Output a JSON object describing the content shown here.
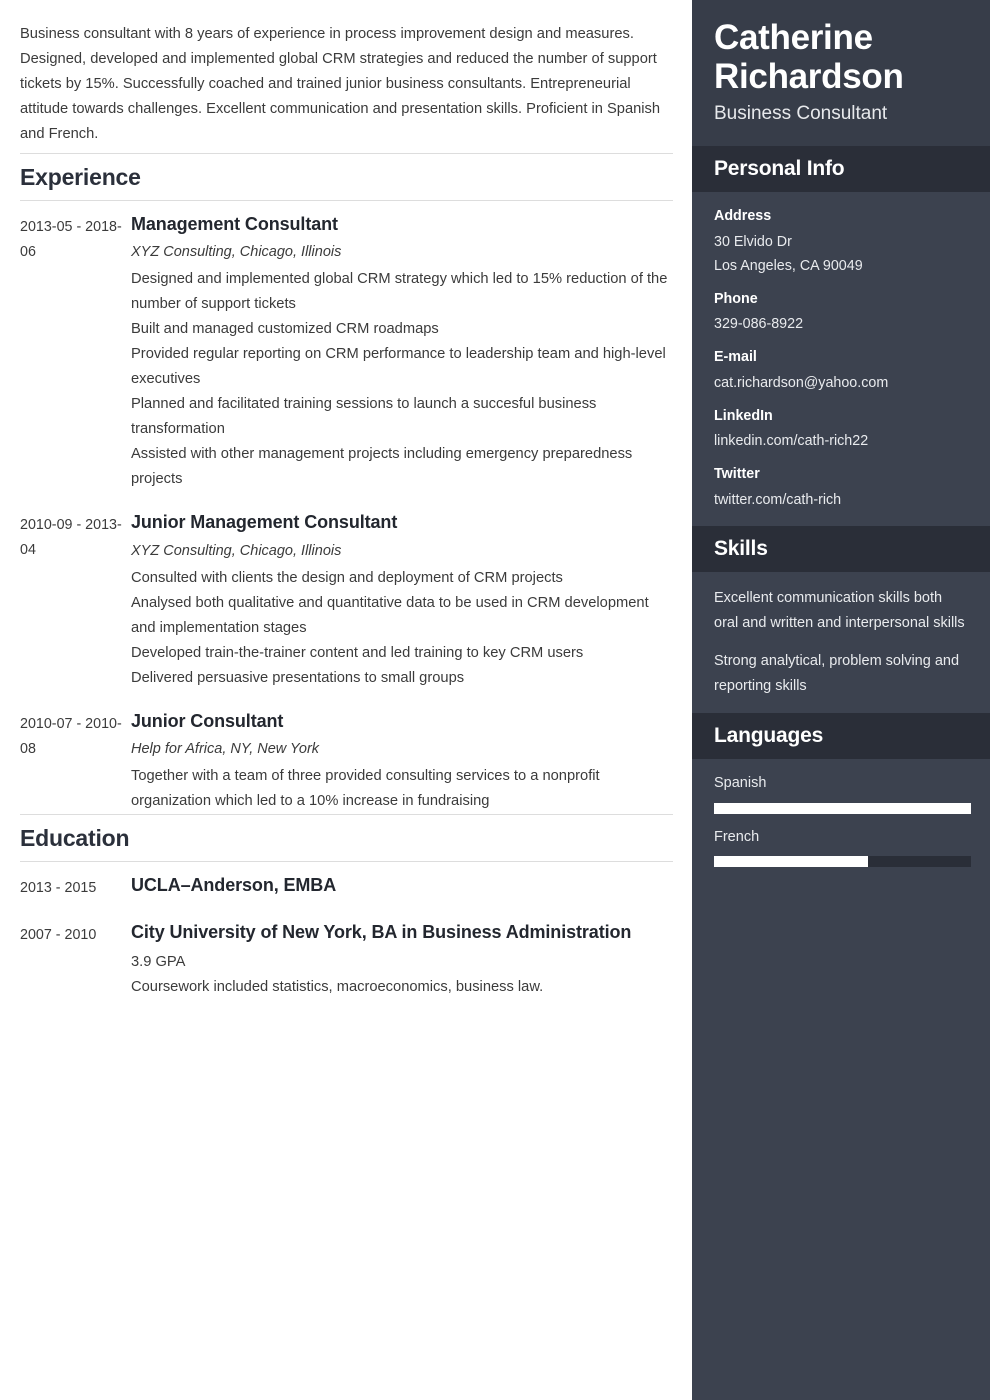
{
  "theme": {
    "sidebar_bg": "#3c424f",
    "sidebar_header_bg": "#2a2e38",
    "sidebar_name_bg": "#373d49",
    "text_dark": "#3b3b3b",
    "heading_dark": "#2b303b",
    "bar_fill": "#ffffff",
    "rule": "#dddddd"
  },
  "summary": "Business consultant with 8 years of experience in process improvement design and measures. Designed, developed and implemented global CRM strategies and reduced the number of support tickets by 15%. Successfully coached and trained junior business consultants. Entrepreneurial attitude towards challenges. Excellent communication and presentation skills. Proficient in Spanish and French.",
  "experience": {
    "title": "Experience",
    "entries": [
      {
        "dates": "2013-05 - 2018-06",
        "title": "Management Consultant",
        "subtitle": "XYZ Consulting, Chicago, Illinois",
        "bullets": [
          "Designed and implemented global CRM strategy which led to 15% reduction of the number of support tickets",
          "Built and managed customized CRM roadmaps",
          "Provided regular reporting on CRM performance to leadership team and high-level executives",
          "Planned and facilitated training sessions to launch a succesful business transformation",
          "Assisted with other management projects including emergency preparedness projects"
        ]
      },
      {
        "dates": "2010-09 - 2013-04",
        "title": "Junior Management Consultant",
        "subtitle": "XYZ Consulting, Chicago, Illinois",
        "bullets": [
          "Consulted with clients the design and deployment of CRM projects",
          "Analysed both qualitative and quantitative data to be used in CRM development and implementation stages",
          "Developed train-the-trainer content and led training to key CRM users",
          "Delivered persuasive presentations to small groups"
        ]
      },
      {
        "dates": "2010-07 - 2010-08",
        "title": "Junior Consultant",
        "subtitle": "Help for Africa, NY, New York",
        "bullets": [
          "Together with a team of three provided consulting services to a nonprofit organization which led to a 10% increase in fundraising"
        ]
      }
    ]
  },
  "education": {
    "title": "Education",
    "entries": [
      {
        "dates": "2013 - 2015",
        "title": "UCLA–Anderson, EMBA",
        "subtitle": "",
        "bullets": []
      },
      {
        "dates": "2007 - 2010",
        "title": "City University of New York, BA in Business Administration",
        "subtitle": "",
        "bullets": [
          "3.9 GPA",
          "Coursework included statistics, macroeconomics, business law."
        ]
      }
    ]
  },
  "sidebar": {
    "name": "Catherine Richardson",
    "role": "Business Consultant",
    "personal_info": {
      "title": "Personal Info",
      "items": [
        {
          "label": "Address",
          "value": "30 Elvido Dr\nLos Angeles, CA 90049",
          "line1": "30 Elvido Dr",
          "line2": "Los Angeles, CA 90049"
        },
        {
          "label": "Phone",
          "value": "329-086-8922",
          "line1": "329-086-8922",
          "line2": ""
        },
        {
          "label": "E-mail",
          "value": "cat.richardson@yahoo.com",
          "line1": "cat.richardson@yahoo.com",
          "line2": ""
        },
        {
          "label": "LinkedIn",
          "value": "linkedin.com/cath-rich22",
          "line1": "linkedin.com/cath-rich22",
          "line2": ""
        },
        {
          "label": "Twitter",
          "value": "twitter.com/cath-rich",
          "line1": "twitter.com/cath-rich",
          "line2": ""
        }
      ]
    },
    "skills": {
      "title": "Skills",
      "items": [
        "Excellent communication skills both oral and written and interpersonal skills",
        "Strong analytical, problem solving and reporting skills"
      ]
    },
    "languages": {
      "title": "Languages",
      "items": [
        {
          "name": "Spanish",
          "level_percent": 100
        },
        {
          "name": "French",
          "level_percent": 60
        }
      ]
    }
  }
}
